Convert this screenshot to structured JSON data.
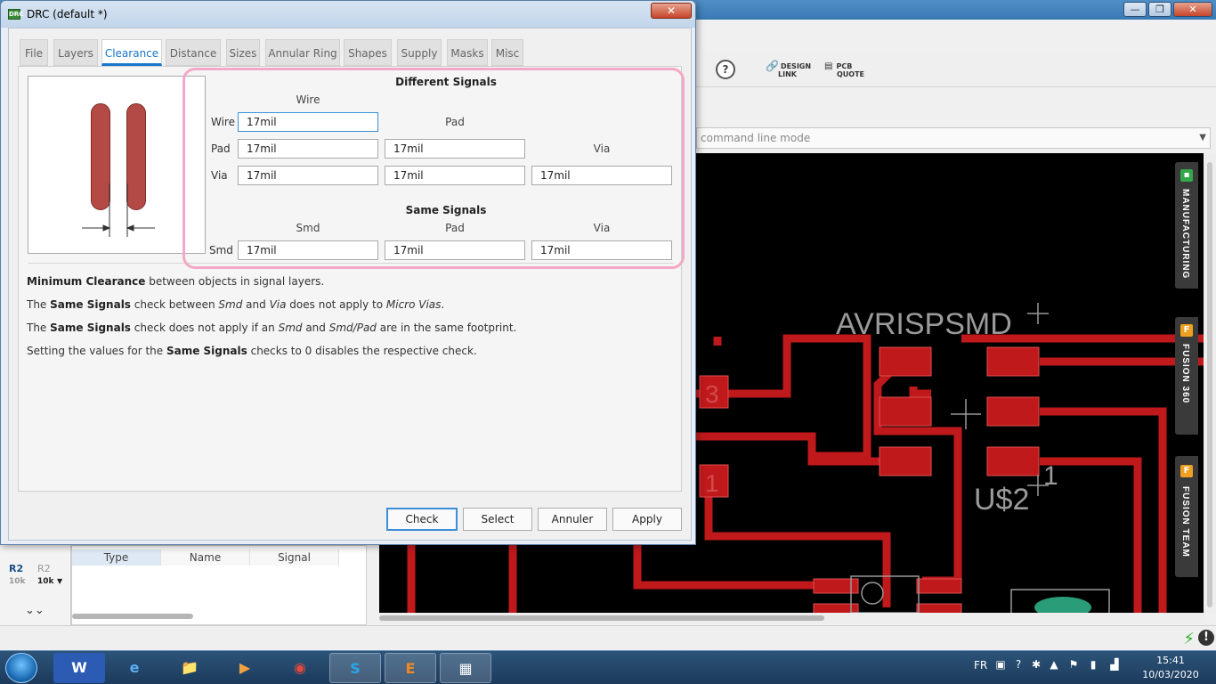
{
  "background_app": {
    "window_controls": [
      "—",
      "❐",
      "✕"
    ],
    "toolbar": {
      "help": "?",
      "design_link": [
        "DESIGN",
        "LINK"
      ],
      "pcb_quote": [
        "PCB",
        "QUOTE"
      ]
    },
    "command_line": "command line mode",
    "side_panels": [
      "MANUFACTURING",
      "FUSION 360",
      "FUSION TEAM"
    ],
    "pcb": {
      "part_name": "AVRISPSMD",
      "part_ref": "U$2",
      "pin_number": "1",
      "pad_labels": [
        "3",
        "1"
      ]
    },
    "bottom_left": {
      "parts": [
        {
          "name": "R2",
          "value": "10k"
        },
        {
          "name": "R2",
          "value": "10k"
        }
      ],
      "table_columns": [
        "Type",
        "Name",
        "Signal"
      ]
    }
  },
  "taskbar": {
    "language": "FR",
    "time": "15:41",
    "date": "10/03/2020",
    "apps": [
      "W",
      "e",
      "📁",
      "▶",
      "◉",
      "S",
      "E",
      "▦"
    ]
  },
  "dialog": {
    "title": "DRC (default *)",
    "close": "✕",
    "tabs": [
      "File",
      "Layers",
      "Clearance",
      "Distance",
      "Sizes",
      "Annular Ring",
      "Shapes",
      "Supply",
      "Masks",
      "Misc"
    ],
    "active_tab": "Clearance",
    "different_signals": {
      "heading": "Different Signals",
      "columns": [
        "Wire",
        "Pad",
        "Via"
      ],
      "rows": [
        {
          "label": "Wire",
          "values": [
            "17mil"
          ]
        },
        {
          "label": "Pad",
          "values": [
            "17mil",
            "17mil"
          ]
        },
        {
          "label": "Via",
          "values": [
            "17mil",
            "17mil",
            "17mil"
          ]
        }
      ]
    },
    "same_signals": {
      "heading": "Same Signals",
      "columns": [
        "Smd",
        "Pad",
        "Via"
      ],
      "rows": [
        {
          "label": "Smd",
          "values": [
            "17mil",
            "17mil",
            "17mil"
          ]
        }
      ]
    },
    "description": [
      {
        "bold": "Minimum Clearance",
        "rest": " between objects in signal layers."
      },
      {
        "pre": "The ",
        "bold": "Same Signals",
        "mid": " check between ",
        "it1": "Smd",
        "and": " and ",
        "it2": "Via",
        "rest": " does not apply to ",
        "it3": "Micro Vias",
        "end": "."
      },
      {
        "pre": "The ",
        "bold": "Same Signals",
        "mid": " check does not apply if an ",
        "it1": "Smd",
        "and": " and ",
        "it2": "Smd/Pad",
        "rest": " are in the same footprint."
      },
      {
        "pre": "Setting the values for the ",
        "bold": "Same Signals",
        "rest": " checks to 0 disables the respective check."
      }
    ],
    "buttons": [
      "Check",
      "Select",
      "Annuler",
      "Apply"
    ]
  }
}
